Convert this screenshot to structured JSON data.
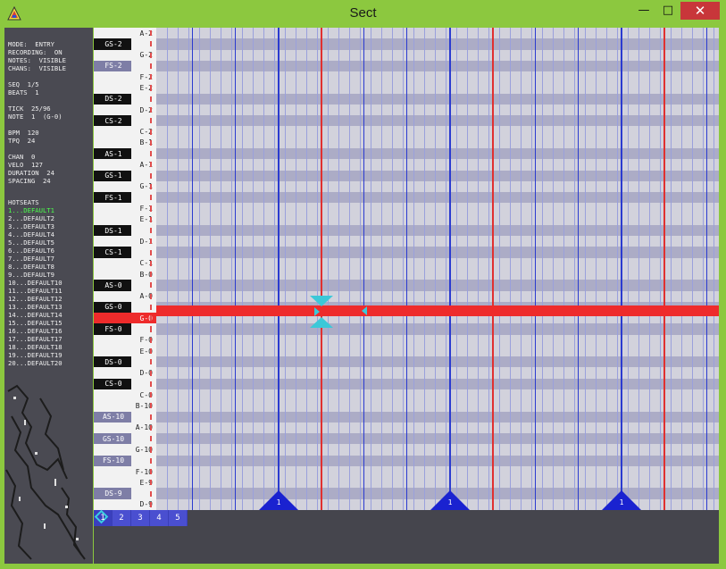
{
  "window": {
    "title": "Sect",
    "minimize_glyph": "—",
    "maximize_glyph": "□",
    "close_glyph": "✕"
  },
  "status": {
    "lines": [
      "MODE:  ENTRY",
      "RECORDING:  ON",
      "NOTES:  VISIBLE",
      "CHANS:  VISIBLE",
      "",
      "SEQ  1/5",
      "BEATS  1",
      "",
      "TICK  25/96",
      "NOTE  1  (G-0)",
      "",
      "BPM  120",
      "TPQ  24",
      "",
      "CHAN  0",
      "VELO  127",
      "DURATION  24",
      "SPACING  24"
    ],
    "hotseats_label": "HOTSEATS",
    "hotseats": [
      "1...DEFAULT1",
      "2...DEFAULT2",
      "3...DEFAULT3",
      "4...DEFAULT4",
      "5...DEFAULT5",
      "6...DEFAULT6",
      "7...DEFAULT7",
      "8...DEFAULT8",
      "9...DEFAULT9",
      "10...DEFAULT10",
      "11...DEFAULT11",
      "12...DEFAULT12",
      "13...DEFAULT13",
      "14...DEFAULT14",
      "15...DEFAULT15",
      "16...DEFAULT16",
      "17...DEFAULT17",
      "18...DEFAULT18",
      "19...DEFAULT19",
      "20...DEFAULT20"
    ],
    "active_hotseat": 1
  },
  "keys": [
    {
      "label": "A-2",
      "black": false
    },
    {
      "label": "GS-2",
      "black": true
    },
    {
      "label": "G-2",
      "black": false
    },
    {
      "label": "FS-2",
      "black": true,
      "lav": true
    },
    {
      "label": "F-2",
      "black": false
    },
    {
      "label": "E-2",
      "black": false
    },
    {
      "label": "DS-2",
      "black": true
    },
    {
      "label": "D-2",
      "black": false
    },
    {
      "label": "CS-2",
      "black": true
    },
    {
      "label": "C-2",
      "black": false
    },
    {
      "label": "B-1",
      "black": false
    },
    {
      "label": "AS-1",
      "black": true
    },
    {
      "label": "A-1",
      "black": false
    },
    {
      "label": "GS-1",
      "black": true
    },
    {
      "label": "G-1",
      "black": false
    },
    {
      "label": "FS-1",
      "black": true
    },
    {
      "label": "F-1",
      "black": false
    },
    {
      "label": "E-1",
      "black": false
    },
    {
      "label": "DS-1",
      "black": true
    },
    {
      "label": "D-1",
      "black": false
    },
    {
      "label": "CS-1",
      "black": true
    },
    {
      "label": "C-1",
      "black": false
    },
    {
      "label": "B-0",
      "black": false
    },
    {
      "label": "AS-0",
      "black": true
    },
    {
      "label": "A-0",
      "black": false
    },
    {
      "label": "GS-0",
      "black": true
    },
    {
      "label": "G-0",
      "black": false,
      "current": true
    },
    {
      "label": "FS-0",
      "black": true
    },
    {
      "label": "F-0",
      "black": false
    },
    {
      "label": "E-0",
      "black": false
    },
    {
      "label": "DS-0",
      "black": true
    },
    {
      "label": "D-0",
      "black": false
    },
    {
      "label": "CS-0",
      "black": true
    },
    {
      "label": "C-0",
      "black": false
    },
    {
      "label": "B-10",
      "black": false
    },
    {
      "label": "AS-10",
      "black": true,
      "lav": true
    },
    {
      "label": "A-10",
      "black": false
    },
    {
      "label": "GS-10",
      "black": true,
      "lav": true
    },
    {
      "label": "G-10",
      "black": false
    },
    {
      "label": "FS-10",
      "black": true,
      "lav": true
    },
    {
      "label": "F-10",
      "black": false
    },
    {
      "label": "E-9",
      "black": false
    },
    {
      "label": "DS-9",
      "black": true,
      "lav": true
    },
    {
      "label": "D-9",
      "black": false
    }
  ],
  "grid": {
    "colors": {
      "row_light": "#d2d2dc",
      "row_dark": "#acacc6",
      "beat": "#2b3bd0",
      "bar": "#e03030",
      "note": "#ee2b2b",
      "cursor": "#3cc8d8",
      "marker": "#1a22d0"
    },
    "bar_markers": [
      "1",
      "1",
      "1"
    ]
  },
  "sequences": {
    "tabs": [
      "1",
      "2",
      "3",
      "4",
      "5"
    ],
    "active": 0
  }
}
